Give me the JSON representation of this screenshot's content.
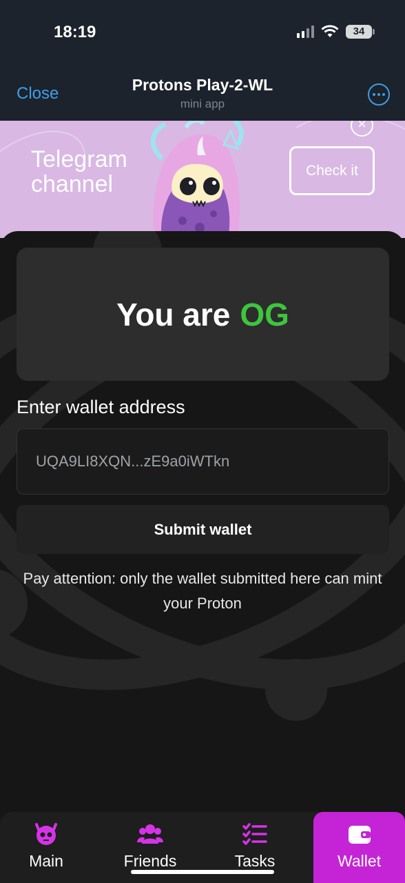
{
  "status": {
    "time": "18:19",
    "battery": "34"
  },
  "header": {
    "close": "Close",
    "title": "Protons Play-2-WL",
    "subtitle": "mini app"
  },
  "banner": {
    "text": "Telegram channel",
    "button": "Check it"
  },
  "og": {
    "prefix": "You are",
    "highlight": "OG"
  },
  "wallet": {
    "label": "Enter wallet address",
    "value": "UQA9LI8XQN...zE9a0iWTkn",
    "submit": "Submit wallet",
    "note": "Pay attention: only the wallet submitted here can mint your Proton"
  },
  "nav": {
    "main": "Main",
    "friends": "Friends",
    "tasks": "Tasks",
    "wallet": "Wallet",
    "active": "wallet"
  },
  "colors": {
    "accent_link": "#3f9ee8",
    "og_green": "#3ec53e",
    "nav_active": "#c424d6",
    "nav_icon": "#d633e8",
    "banner_bg": "#d9b8e3"
  }
}
